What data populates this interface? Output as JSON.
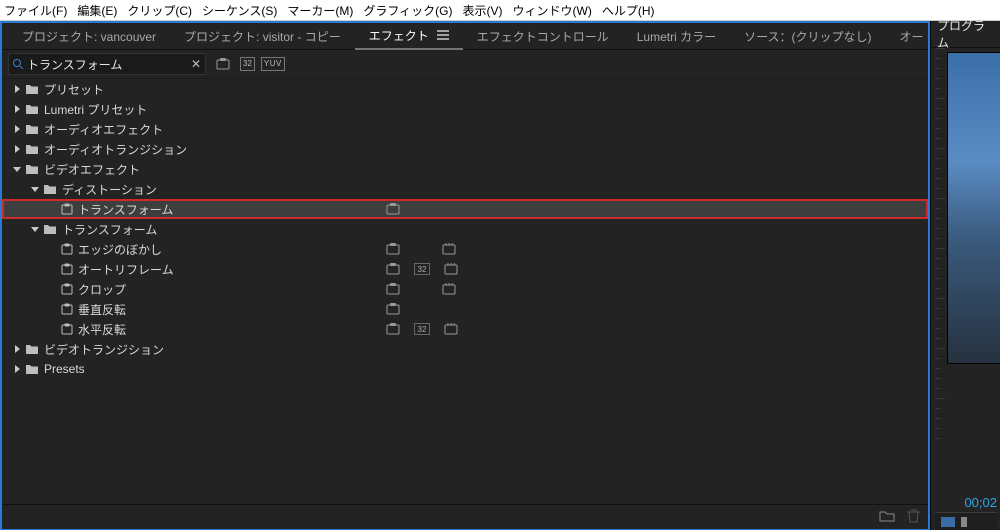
{
  "menubar": [
    "ファイル(F)",
    "編集(E)",
    "クリップ(C)",
    "シーケンス(S)",
    "マーカー(M)",
    "グラフィック(G)",
    "表示(V)",
    "ウィンドウ(W)",
    "ヘルプ(H)"
  ],
  "tabs": {
    "items": [
      {
        "label": "プロジェクト: vancouver",
        "active": false
      },
      {
        "label": "プロジェクト: visitor - コピー",
        "active": false
      },
      {
        "label": "エフェクト",
        "active": true
      },
      {
        "label": "エフェクトコントロール",
        "active": false
      },
      {
        "label": "Lumetri カラー",
        "active": false
      },
      {
        "label": "ソース：(クリップなし)",
        "active": false
      },
      {
        "label": "オー",
        "active": false
      }
    ]
  },
  "search": {
    "value": "トランスフォーム"
  },
  "badges": {
    "b32": "32",
    "yuv": "YUV"
  },
  "tree": [
    {
      "depth": 0,
      "type": "folder",
      "arrow": "right",
      "label": "プリセット"
    },
    {
      "depth": 0,
      "type": "folder",
      "arrow": "right",
      "label": "Lumetri プリセット"
    },
    {
      "depth": 0,
      "type": "folder",
      "arrow": "right",
      "label": "オーディオエフェクト"
    },
    {
      "depth": 0,
      "type": "folder",
      "arrow": "right",
      "label": "オーディオトランジション"
    },
    {
      "depth": 0,
      "type": "folder",
      "arrow": "down",
      "label": "ビデオエフェクト"
    },
    {
      "depth": 1,
      "type": "folder",
      "arrow": "down",
      "label": "ディストーション"
    },
    {
      "depth": 2,
      "type": "preset",
      "label": "トランスフォーム",
      "selected": true,
      "highlight": true,
      "icons": [
        "cal"
      ]
    },
    {
      "depth": 1,
      "type": "folder",
      "arrow": "down",
      "label": "トランスフォーム"
    },
    {
      "depth": 2,
      "type": "preset",
      "label": "エッジのぼかし",
      "icons": [
        "cal",
        "",
        "gpu"
      ]
    },
    {
      "depth": 2,
      "type": "preset",
      "label": "オートリフレーム",
      "icons": [
        "cal",
        "b32",
        "gpu"
      ]
    },
    {
      "depth": 2,
      "type": "preset",
      "label": "クロップ",
      "icons": [
        "cal",
        "",
        "gpu"
      ]
    },
    {
      "depth": 2,
      "type": "preset",
      "label": "垂直反転",
      "icons": [
        "cal"
      ]
    },
    {
      "depth": 2,
      "type": "preset",
      "label": "水平反転",
      "icons": [
        "cal",
        "b32",
        "gpu"
      ]
    },
    {
      "depth": 0,
      "type": "folder",
      "arrow": "right",
      "label": "ビデオトランジション"
    },
    {
      "depth": 0,
      "type": "folder",
      "arrow": "right",
      "label": "Presets"
    }
  ],
  "right": {
    "tab": "プログラム",
    "timecode": "00;02"
  }
}
